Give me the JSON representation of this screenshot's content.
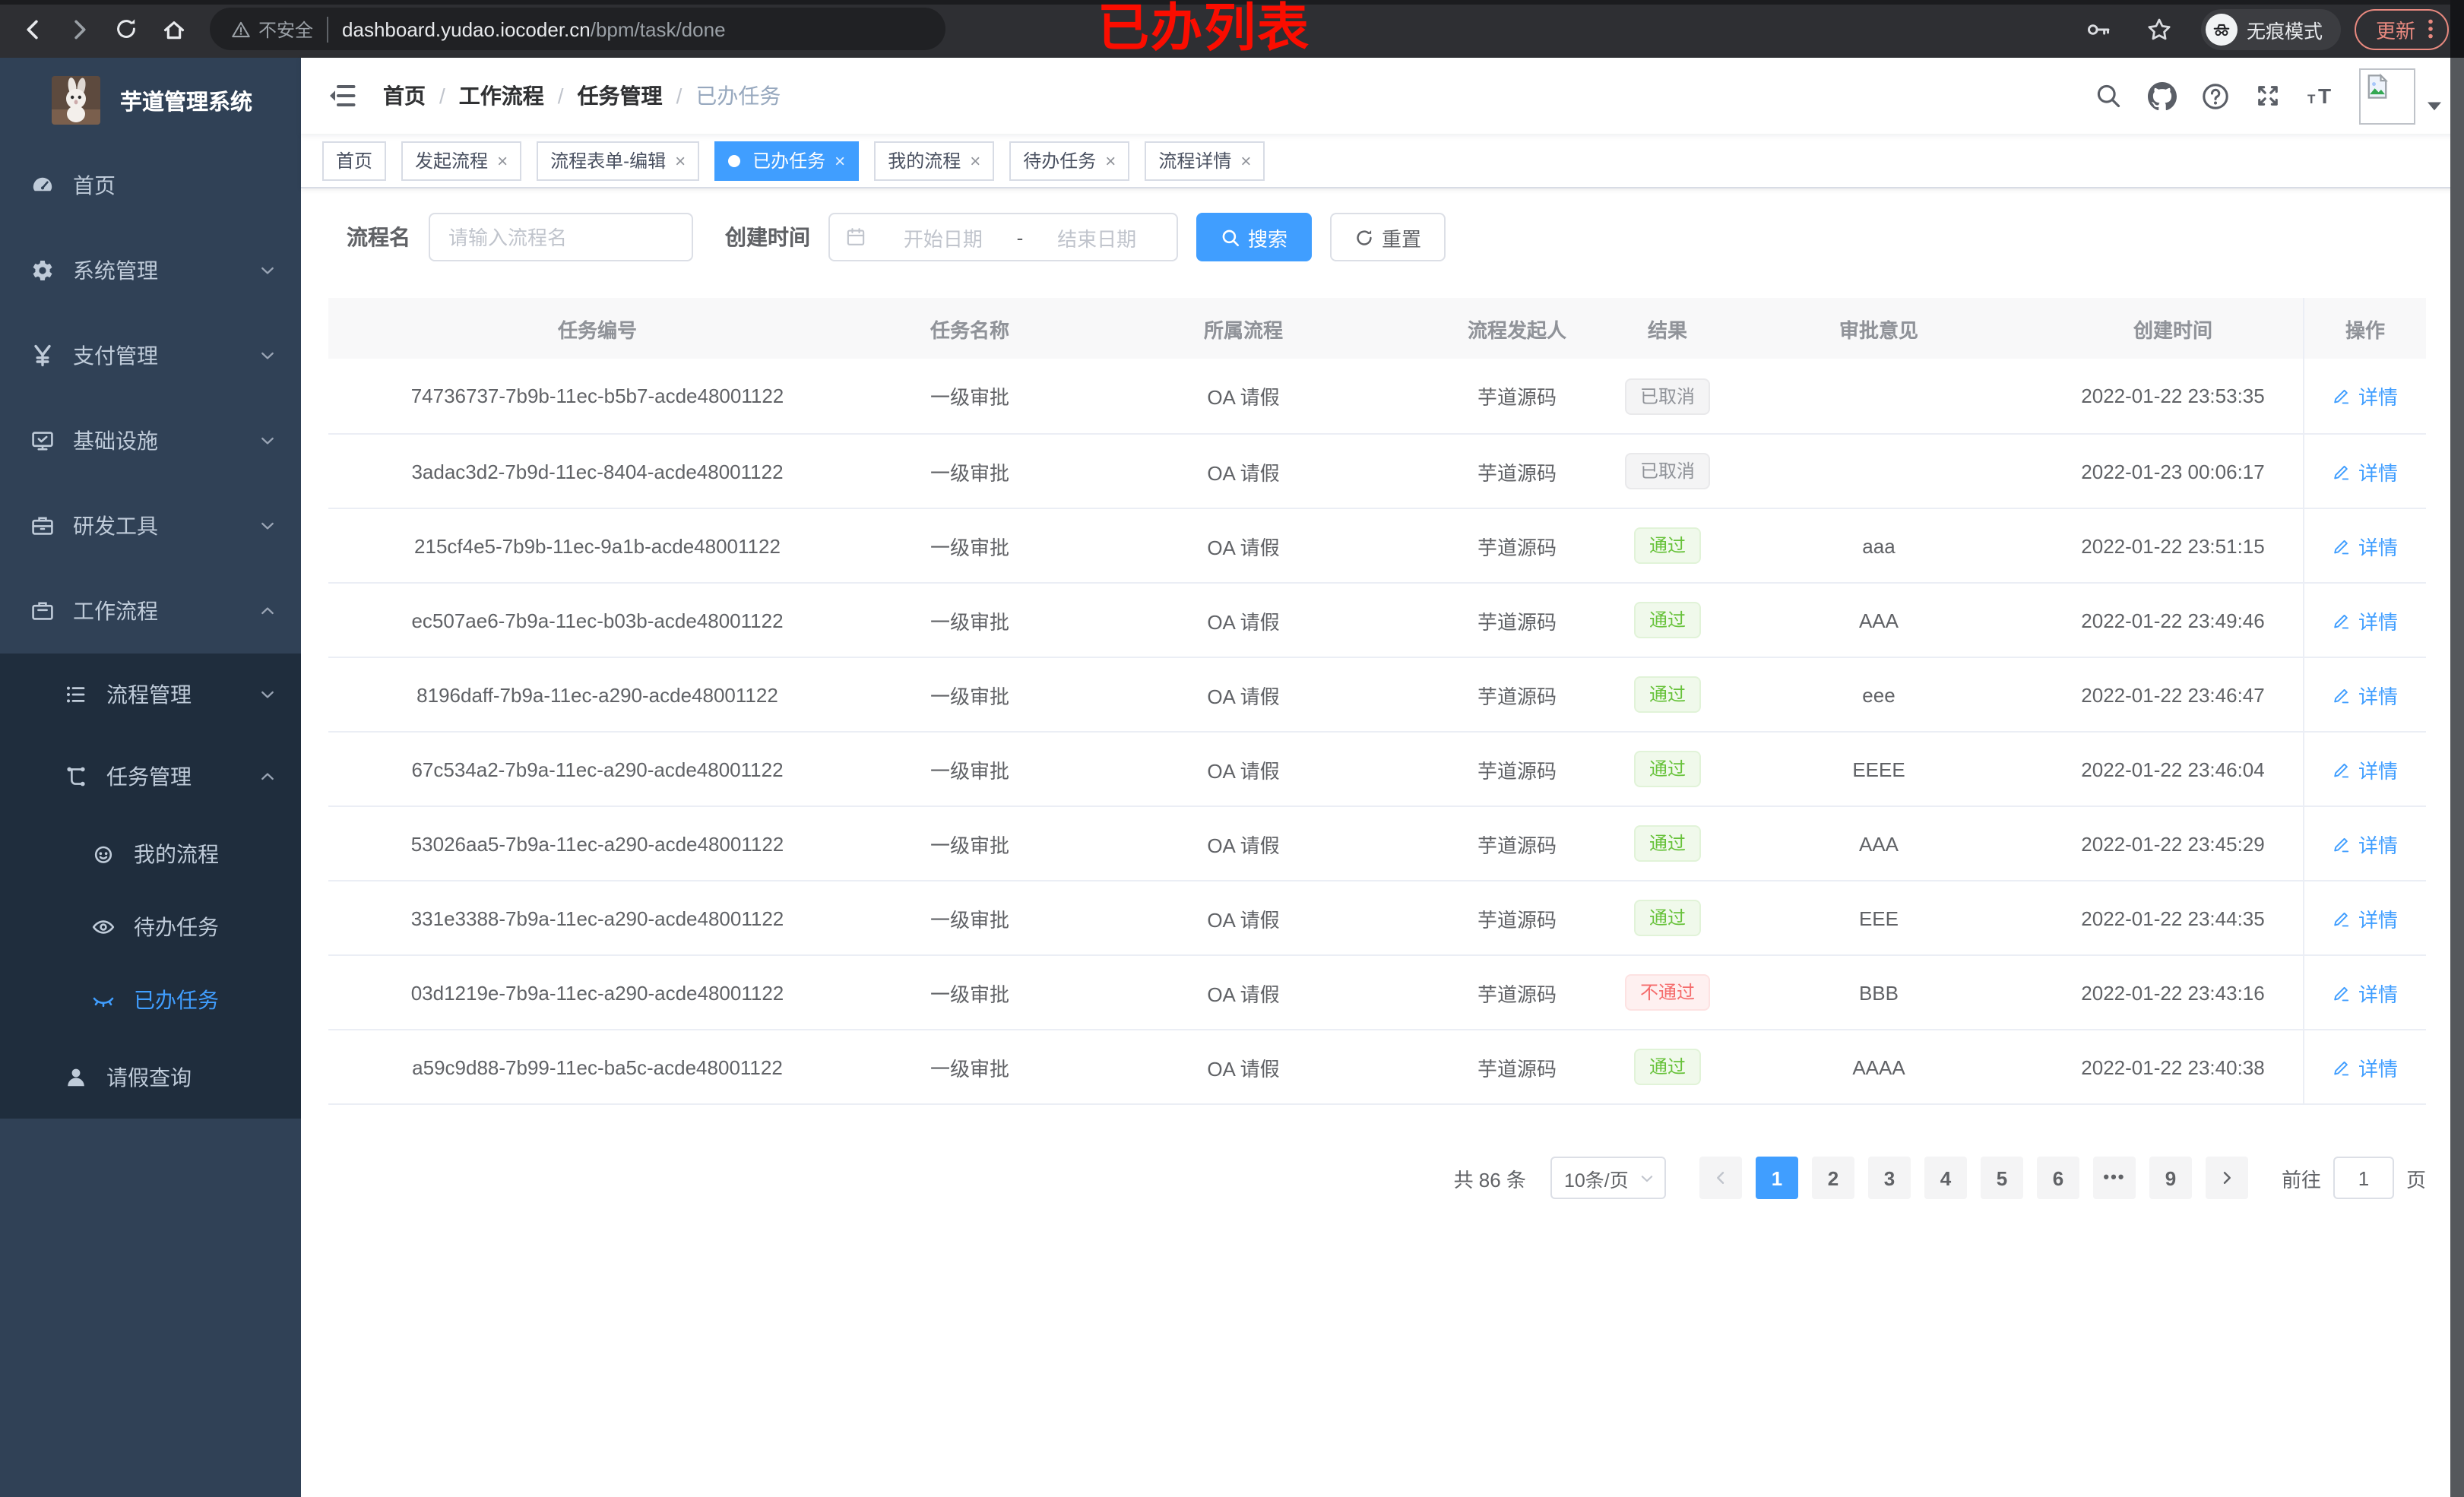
{
  "colors": {
    "accent": "#409eff",
    "success_text": "#67c23a",
    "danger_text": "#f56c6c",
    "info_text": "#909399",
    "sidebar_bg": "#304156",
    "submenu_bg": "#1f2d3d",
    "annotation_red": "#fb0d00",
    "update_button": "#e8897f",
    "chrome_bg": "#2e2f33"
  },
  "browser": {
    "security_label": "不安全",
    "url_host": "dashboard.yudao.iocoder.cn",
    "url_path": "/bpm/task/done",
    "incognito_label": "无痕模式",
    "update_label": "更新",
    "annotation": "已办列表"
  },
  "sidebar": {
    "app_title": "芋道管理系统",
    "items": [
      {
        "label": "首页"
      },
      {
        "label": "系统管理"
      },
      {
        "label": "支付管理"
      },
      {
        "label": "基础设施"
      },
      {
        "label": "研发工具"
      },
      {
        "label": "工作流程"
      },
      {
        "label": "流程管理"
      },
      {
        "label": "任务管理"
      },
      {
        "label": "我的流程"
      },
      {
        "label": "待办任务"
      },
      {
        "label": "已办任务"
      },
      {
        "label": "请假查询"
      }
    ]
  },
  "navbar": {
    "breadcrumb": [
      "首页",
      "工作流程",
      "任务管理",
      "已办任务"
    ],
    "breadcrumb_separator": "/"
  },
  "tabs": {
    "close_glyph": "×",
    "items": [
      {
        "label": "首页",
        "closable": false,
        "active": false
      },
      {
        "label": "发起流程",
        "closable": true,
        "active": false
      },
      {
        "label": "流程表单-编辑",
        "closable": true,
        "active": false
      },
      {
        "label": "已办任务",
        "closable": true,
        "active": true
      },
      {
        "label": "我的流程",
        "closable": true,
        "active": false
      },
      {
        "label": "待办任务",
        "closable": true,
        "active": false
      },
      {
        "label": "流程详情",
        "closable": true,
        "active": false
      }
    ]
  },
  "filters": {
    "process_name_label": "流程名",
    "process_name_placeholder": "请输入流程名",
    "create_time_label": "创建时间",
    "date_start_placeholder": "开始日期",
    "date_separator": "-",
    "date_end_placeholder": "结束日期",
    "search_label": "搜索",
    "reset_label": "重置"
  },
  "table": {
    "columns": [
      "任务编号",
      "任务名称",
      "所属流程",
      "流程发起人",
      "结果",
      "审批意见",
      "创建时间",
      "操作"
    ],
    "rows": [
      {
        "id": "74736737-7b9b-11ec-b5b7-acde48001122",
        "name": "一级审批",
        "process": "OA 请假",
        "initiator": "芋道源码",
        "result": "已取消",
        "result_type": "info",
        "comment": "",
        "created": "2022-01-22 23:53:35",
        "action": "详情"
      },
      {
        "id": "3adac3d2-7b9d-11ec-8404-acde48001122",
        "name": "一级审批",
        "process": "OA 请假",
        "initiator": "芋道源码",
        "result": "已取消",
        "result_type": "info",
        "comment": "",
        "created": "2022-01-23 00:06:17",
        "action": "详情"
      },
      {
        "id": "215cf4e5-7b9b-11ec-9a1b-acde48001122",
        "name": "一级审批",
        "process": "OA 请假",
        "initiator": "芋道源码",
        "result": "通过",
        "result_type": "success",
        "comment": "aaa",
        "created": "2022-01-22 23:51:15",
        "action": "详情"
      },
      {
        "id": "ec507ae6-7b9a-11ec-b03b-acde48001122",
        "name": "一级审批",
        "process": "OA 请假",
        "initiator": "芋道源码",
        "result": "通过",
        "result_type": "success",
        "comment": "AAA",
        "created": "2022-01-22 23:49:46",
        "action": "详情"
      },
      {
        "id": "8196daff-7b9a-11ec-a290-acde48001122",
        "name": "一级审批",
        "process": "OA 请假",
        "initiator": "芋道源码",
        "result": "通过",
        "result_type": "success",
        "comment": "eee",
        "created": "2022-01-22 23:46:47",
        "action": "详情"
      },
      {
        "id": "67c534a2-7b9a-11ec-a290-acde48001122",
        "name": "一级审批",
        "process": "OA 请假",
        "initiator": "芋道源码",
        "result": "通过",
        "result_type": "success",
        "comment": "EEEE",
        "created": "2022-01-22 23:46:04",
        "action": "详情"
      },
      {
        "id": "53026aa5-7b9a-11ec-a290-acde48001122",
        "name": "一级审批",
        "process": "OA 请假",
        "initiator": "芋道源码",
        "result": "通过",
        "result_type": "success",
        "comment": "AAA",
        "created": "2022-01-22 23:45:29",
        "action": "详情"
      },
      {
        "id": "331e3388-7b9a-11ec-a290-acde48001122",
        "name": "一级审批",
        "process": "OA 请假",
        "initiator": "芋道源码",
        "result": "通过",
        "result_type": "success",
        "comment": "EEE",
        "created": "2022-01-22 23:44:35",
        "action": "详情"
      },
      {
        "id": "03d1219e-7b9a-11ec-a290-acde48001122",
        "name": "一级审批",
        "process": "OA 请假",
        "initiator": "芋道源码",
        "result": "不通过",
        "result_type": "danger",
        "comment": "BBB",
        "created": "2022-01-22 23:43:16",
        "action": "详情"
      },
      {
        "id": "a59c9d88-7b99-11ec-ba5c-acde48001122",
        "name": "一级审批",
        "process": "OA 请假",
        "initiator": "芋道源码",
        "result": "通过",
        "result_type": "success",
        "comment": "AAAA",
        "created": "2022-01-22 23:40:38",
        "action": "详情"
      }
    ]
  },
  "pagination": {
    "total": "共 86 条",
    "page_size": "10条/页",
    "pages": [
      "1",
      "2",
      "3",
      "4",
      "5",
      "6",
      "•••",
      "9"
    ],
    "active_page": "1",
    "goto_label": "前往",
    "goto_value": "1",
    "goto_suffix": "页"
  }
}
